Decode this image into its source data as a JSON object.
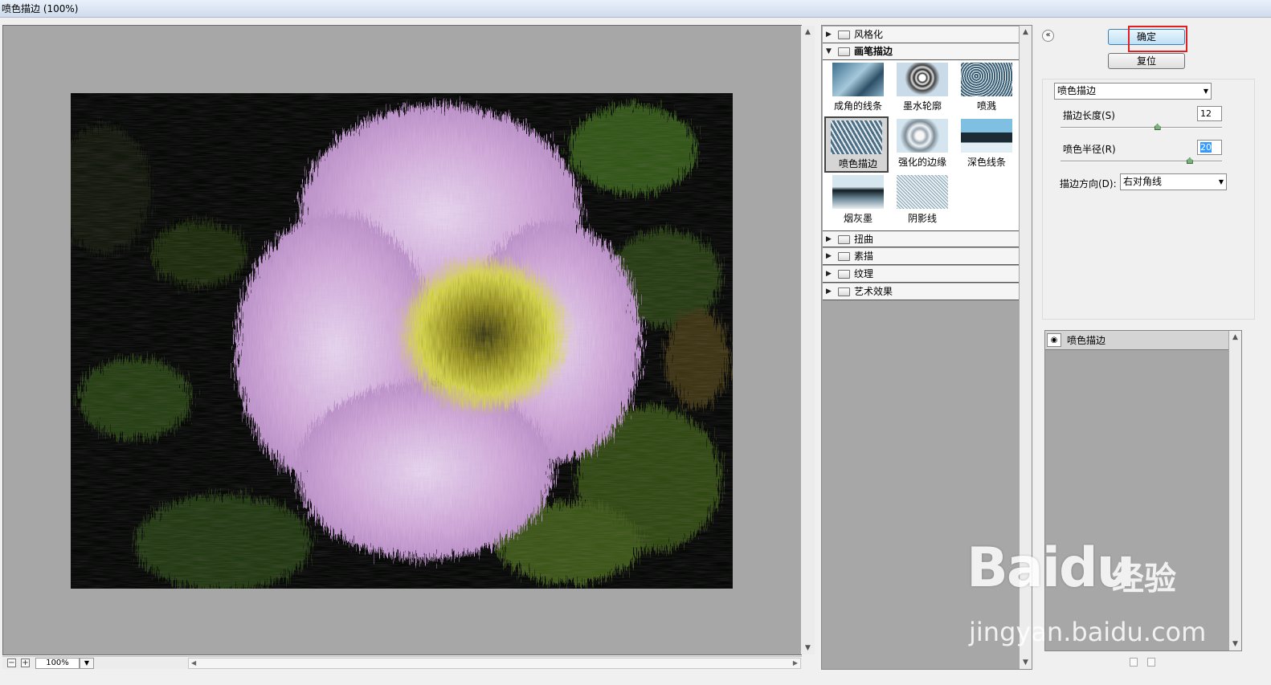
{
  "window": {
    "title": "喷色描边 (100%)"
  },
  "preview": {
    "zoom_value": "100%",
    "zoom_out_symbol": "−",
    "zoom_in_symbol": "+",
    "dropdown_icon": "triangle-down-icon"
  },
  "gallery": {
    "categories_top": [
      {
        "label": "风格化",
        "expanded": false
      }
    ],
    "open_category": {
      "label": "画笔描边",
      "expanded": true
    },
    "thumbnails": [
      "成角的线条",
      "墨水轮廓",
      "喷溅",
      "喷色描边",
      "强化的边缘",
      "深色线条",
      "烟灰墨",
      "阴影线"
    ],
    "selected_thumbnail": "喷色描边",
    "categories_bottom": [
      {
        "label": "扭曲"
      },
      {
        "label": "素描"
      },
      {
        "label": "纹理"
      },
      {
        "label": "艺术效果"
      }
    ]
  },
  "buttons": {
    "ok": "确定",
    "reset": "复位"
  },
  "filter_select": {
    "value": "喷色描边"
  },
  "params": {
    "stroke_length": {
      "label": "描边长度(S)",
      "value": "12",
      "fraction": 0.6
    },
    "spray_radius": {
      "label": "喷色半径(R)",
      "value": "20",
      "fraction": 0.8
    },
    "stroke_direction": {
      "label": "描边方向(D):",
      "value": "右对角线"
    }
  },
  "layers": {
    "items": [
      {
        "label": "喷色描边",
        "visible": true
      }
    ]
  },
  "watermark": {
    "brand": "Bai",
    "brand_sub": "du",
    "suffix": "经验",
    "url": "jingyan.baidu.com"
  },
  "colors": {
    "canvas": "#a7a7a7",
    "highlight_box": "#e02020",
    "ok_button": "#bfe0f4"
  }
}
